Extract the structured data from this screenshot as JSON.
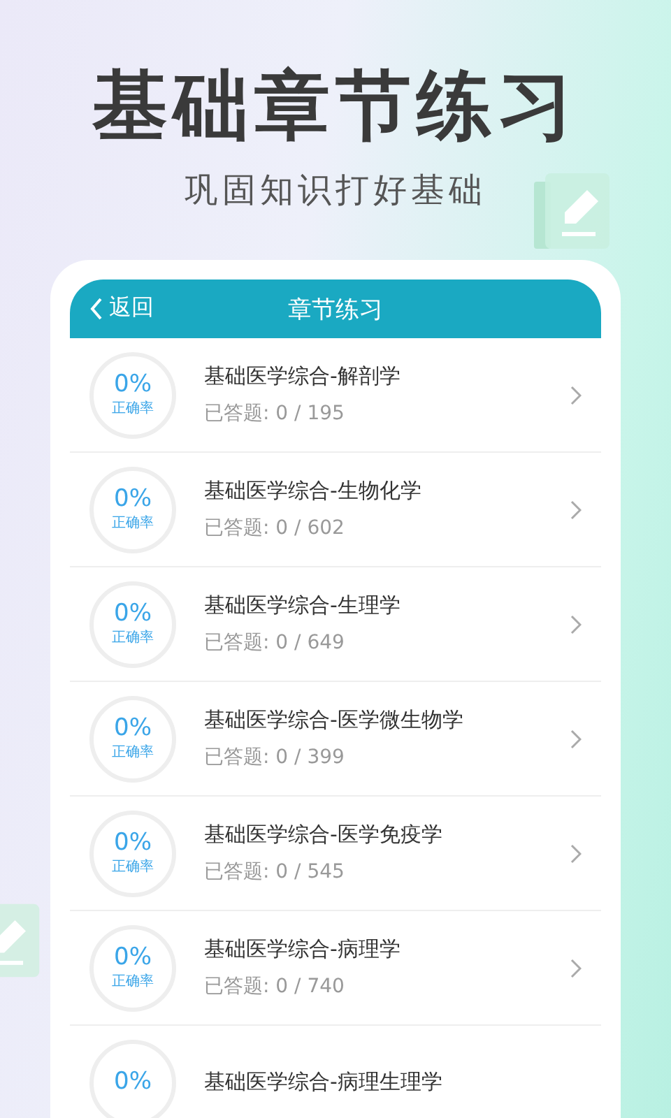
{
  "headline": "基础章节练习",
  "subtitle": "巩固知识打好基础",
  "nav": {
    "back": "返回",
    "title": "章节练习"
  },
  "chapters": [
    {
      "percent": "0%",
      "rate_label": "正确率",
      "title": "基础医学综合-解剖学",
      "answered": "已答题: 0 / 195"
    },
    {
      "percent": "0%",
      "rate_label": "正确率",
      "title": "基础医学综合-生物化学",
      "answered": "已答题: 0 / 602"
    },
    {
      "percent": "0%",
      "rate_label": "正确率",
      "title": "基础医学综合-生理学",
      "answered": "已答题: 0 / 649"
    },
    {
      "percent": "0%",
      "rate_label": "正确率",
      "title": "基础医学综合-医学微生物学",
      "answered": "已答题: 0 / 399"
    },
    {
      "percent": "0%",
      "rate_label": "正确率",
      "title": "基础医学综合-医学免疫学",
      "answered": "已答题: 0 / 545"
    },
    {
      "percent": "0%",
      "rate_label": "正确率",
      "title": "基础医学综合-病理学",
      "answered": "已答题: 0 / 740"
    },
    {
      "percent": "0%",
      "title": "基础医学综合-病理生理学"
    }
  ]
}
